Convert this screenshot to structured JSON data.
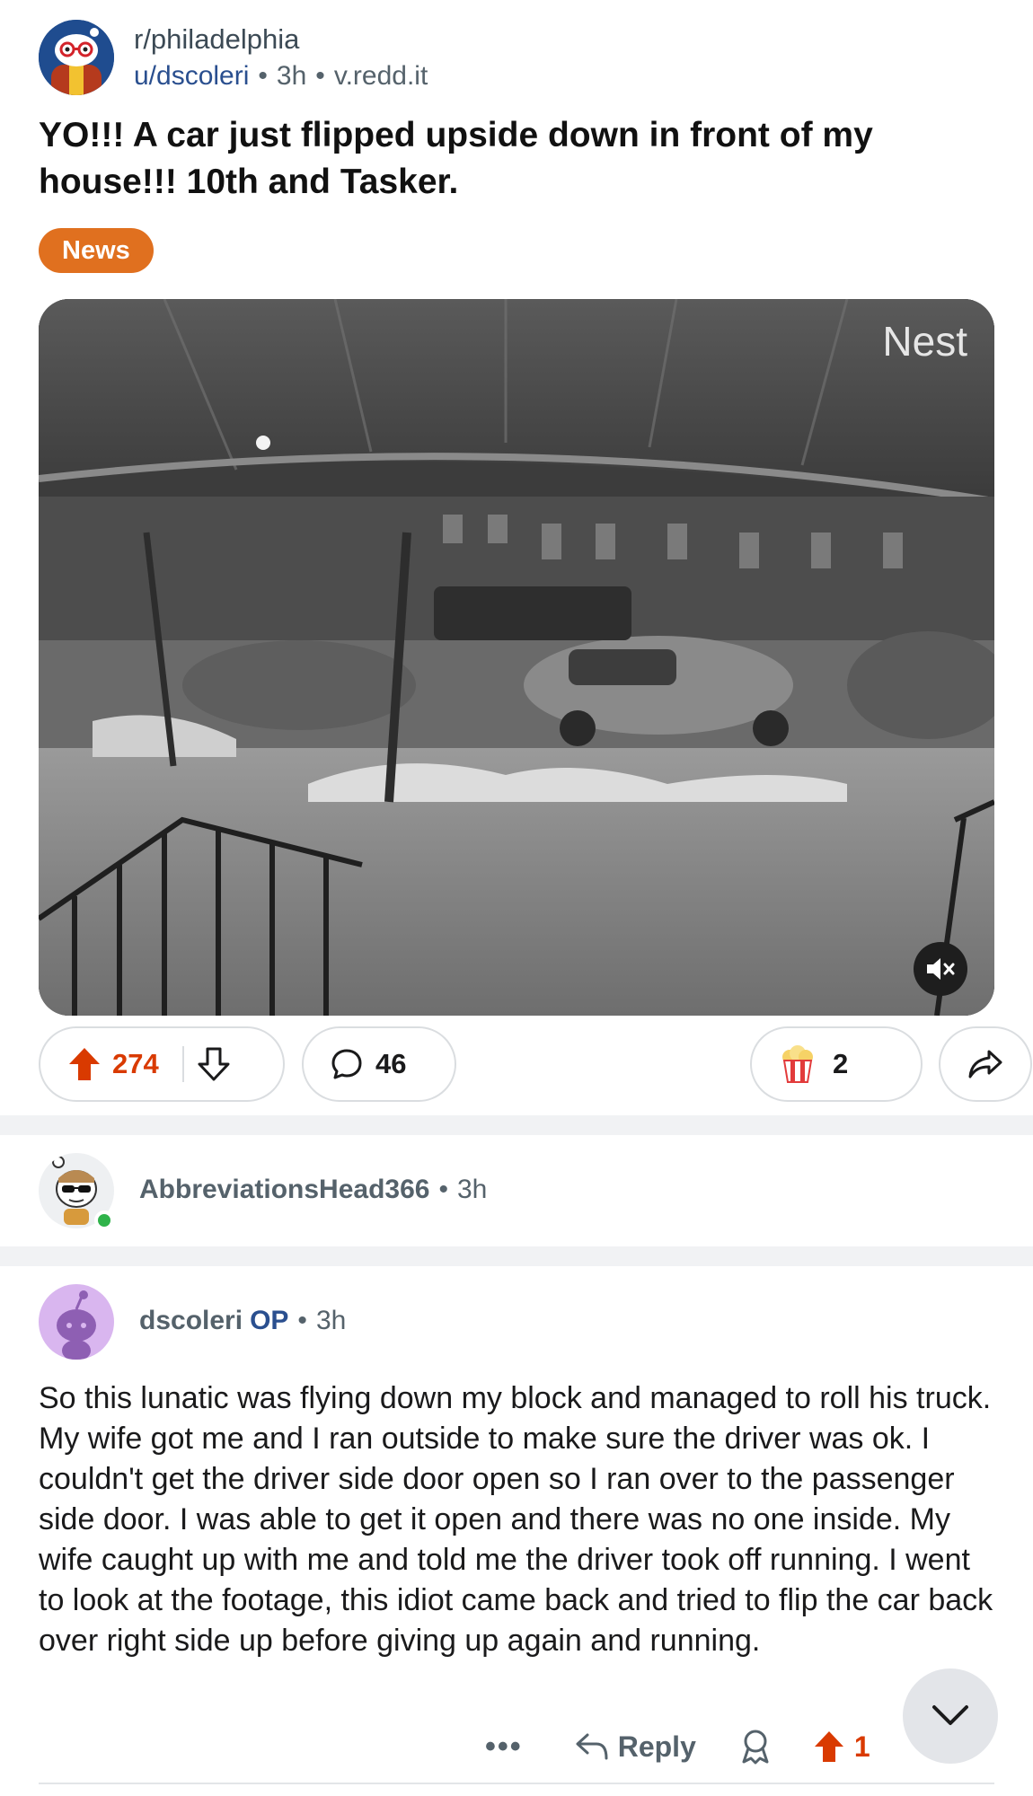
{
  "post": {
    "subreddit": "r/philadelphia",
    "author": "u/dscoleri",
    "age": "3h",
    "domain": "v.redd.it",
    "title": "YO!!! A car just flipped upside down in front of my house!!! 10th and Tasker.",
    "flair": "News",
    "video_watermark": "Nest",
    "upvotes": "274",
    "comments": "46",
    "awards": "2"
  },
  "comments": [
    {
      "author": "AbbreviationsHead366",
      "age": "3h",
      "online": true
    },
    {
      "author": "dscoleri",
      "op_label": "OP",
      "age": "3h",
      "body": "So this lunatic was flying down my block and managed to roll his truck. My wife got me and I ran outside to make sure the driver was ok. I couldn't get the driver side door open so I ran over to the passenger side door. I was able to get it open and there was no one inside. My wife caught up with me and told me the driver took off running. I went to look at the footage, this idiot came back and tried to flip the car back over right side up before giving up again and running.",
      "reply_label": "Reply",
      "more_label": "•••",
      "score": "1"
    }
  ],
  "icons": {
    "upvote": "arrow-up-icon",
    "downvote": "arrow-down-icon",
    "comment": "speech-bubble-icon",
    "award": "popcorn-award-icon",
    "share": "share-arrow-icon",
    "mute": "speaker-muted-icon",
    "reply": "reply-arrow-icon",
    "collapse": "chevron-down-icon"
  },
  "colors": {
    "flair": "#e0701f",
    "upvote_active": "#d93a00",
    "op_label": "#2a4f8f",
    "online": "#2fb34a"
  }
}
